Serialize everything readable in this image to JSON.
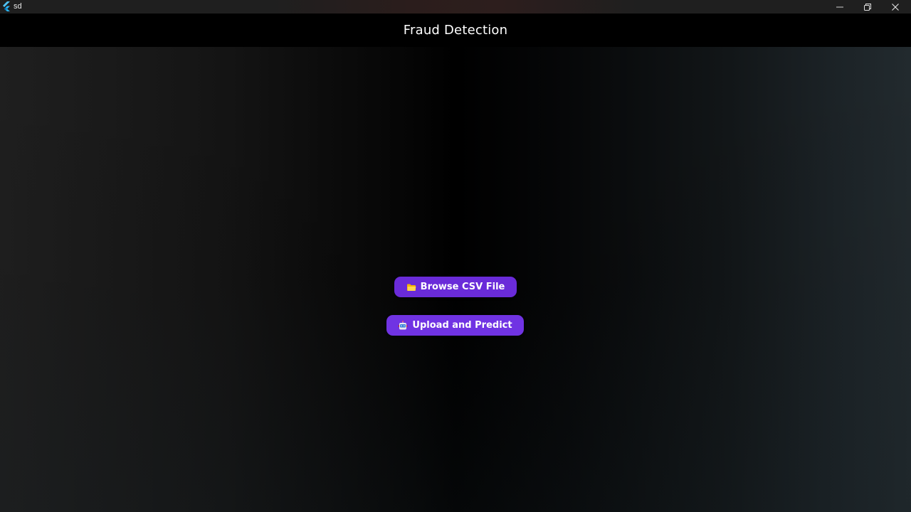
{
  "window": {
    "title": "sd",
    "app_icon": "flutter-icon",
    "controls": [
      "minimize-icon",
      "restore-icon",
      "close-icon"
    ]
  },
  "appbar": {
    "title": "Fraud Detection"
  },
  "actions": {
    "browse_label": "Browse CSV File",
    "browse_icon": "folder-icon",
    "upload_label": "Upload and Predict",
    "upload_icon": "robot-icon"
  },
  "colors": {
    "button": "#6a2bd9",
    "appbar": "#000000",
    "text": "#ffffff"
  }
}
